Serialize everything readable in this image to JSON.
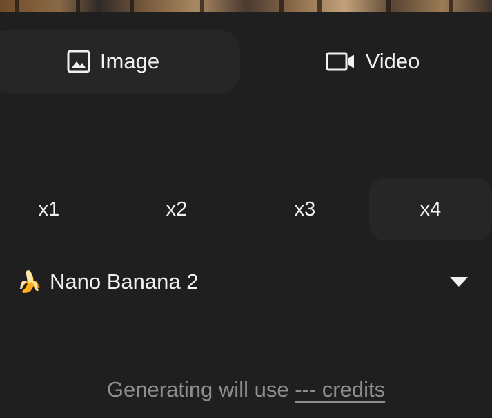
{
  "mode_tabs": [
    {
      "label": "Image",
      "icon": "image-icon",
      "active": true
    },
    {
      "label": "Video",
      "icon": "video-camera-icon",
      "active": false
    }
  ],
  "counts": [
    {
      "label": "x1",
      "active": false
    },
    {
      "label": "x2",
      "active": false
    },
    {
      "label": "x3",
      "active": false
    },
    {
      "label": "x4",
      "active": true
    }
  ],
  "model": {
    "emoji": "🍌",
    "name": "Nano Banana 2",
    "icon": "chevron-down-icon"
  },
  "footer": {
    "text": "Generating will use",
    "credits_link": "--- credits"
  },
  "colors": {
    "background": "#1f1f1f",
    "active_fill": "#262626",
    "text": "#f1f1f1",
    "muted_text": "#8e8e8e"
  }
}
